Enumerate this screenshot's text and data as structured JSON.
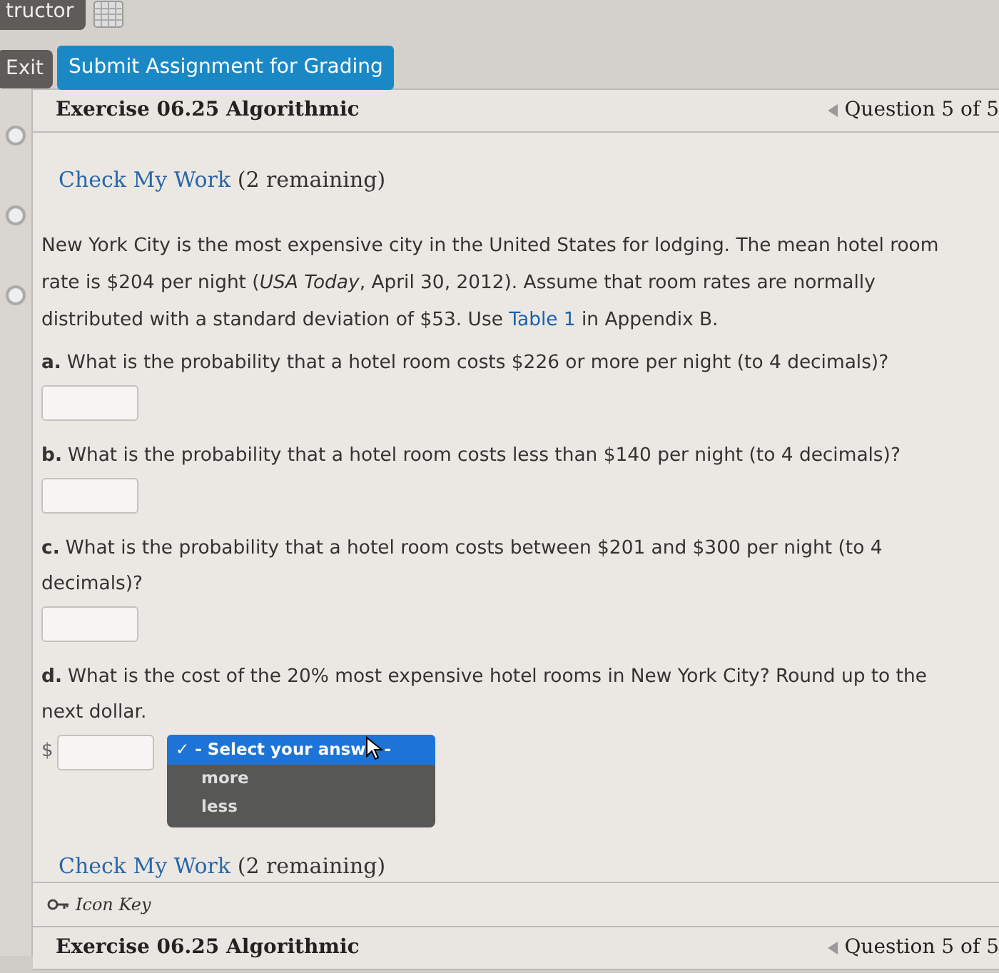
{
  "toolbar": {
    "instructor_button": "tructor",
    "exit_button": "Exit",
    "submit_button": "Submit Assignment for Grading"
  },
  "header": {
    "title": "Exercise 06.25 Algorithmic",
    "nav": "Question 5 of 5"
  },
  "check_top": {
    "link": "Check My Work",
    "note": "(2 remaining)"
  },
  "intro": {
    "before": "New York City is the most expensive city in the United States for lodging. The mean hotel room rate is $204 per night (*USA Today*, April 30, 2012). Assume that room rates are normally distributed with a standard deviation of $53. Use ",
    "link": "Table 1",
    "after": " in Appendix B."
  },
  "questions": [
    {
      "letter": "a.",
      "text": "What is the probability that a hotel room costs $226 or more per night (to 4 decimals)?",
      "kind": "input"
    },
    {
      "letter": "b.",
      "text": "What is the probability that a hotel room costs less than $140 per night (to 4 decimals)?",
      "kind": "input"
    },
    {
      "letter": "c.",
      "text": "What is the probability that a hotel room costs between $201 and $300 per night (to 4 decimals)?",
      "kind": "input"
    },
    {
      "letter": "d.",
      "text": "What is the cost of the 20% most expensive hotel rooms in New York City? Round up to the next dollar.",
      "kind": "currency_select",
      "prefix": "$",
      "options": [
        {
          "check": "✓",
          "label": "- Select your answ",
          "after_cursor": "-",
          "selected": true
        },
        {
          "label": "more",
          "selected": false
        },
        {
          "label": "less",
          "selected": false
        }
      ]
    }
  ],
  "check_bottom": {
    "link": "Check My Work",
    "note": "(2 remaining)"
  },
  "icon_key": "Icon Key",
  "footer": {
    "title": "Exercise 06.25 Algorithmic",
    "nav": "Question 5 of 5"
  }
}
